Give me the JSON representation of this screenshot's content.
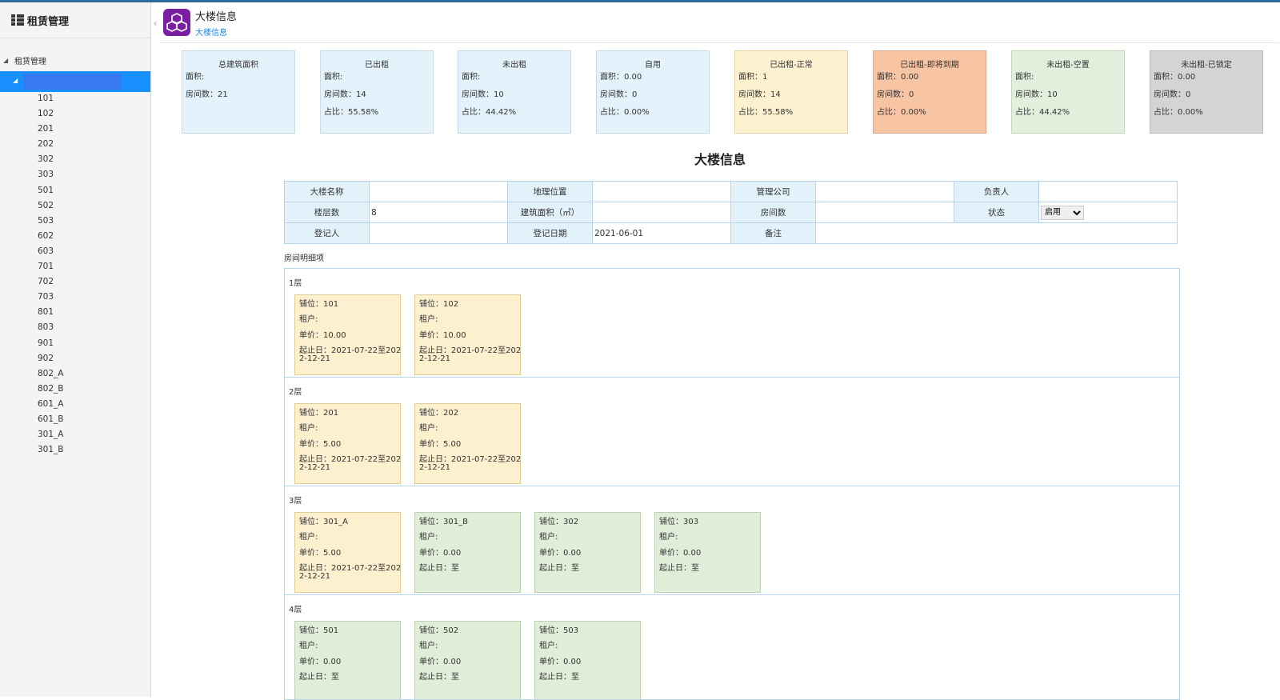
{
  "sidebar": {
    "title": "租赁管理",
    "tree_root": "租赁管理",
    "items": [
      "101",
      "102",
      "201",
      "202",
      "302",
      "303",
      "501",
      "502",
      "503",
      "602",
      "603",
      "701",
      "702",
      "703",
      "801",
      "803",
      "901",
      "902",
      "802_A",
      "802_B",
      "601_A",
      "601_B",
      "301_A",
      "301_B"
    ]
  },
  "header": {
    "title": "大楼信息",
    "breadcrumb": "大楼信息"
  },
  "stats": [
    {
      "title": "总建筑面积",
      "lines": [
        "面积:",
        "房间数：21"
      ],
      "color": "blue"
    },
    {
      "title": "已出租",
      "lines": [
        "面积:",
        "房间数：14",
        "占比：55.58%"
      ],
      "color": "blue"
    },
    {
      "title": "未出租",
      "lines": [
        "面积:",
        "房间数：10",
        "占比：44.42%"
      ],
      "color": "blue"
    },
    {
      "title": "自用",
      "lines": [
        "面积：0.00",
        "房间数：0",
        "占比：0.00%"
      ],
      "color": "blue"
    },
    {
      "title": "已出租-正常",
      "lines": [
        "面积：1",
        "房间数：14",
        "占比：55.58%"
      ],
      "color": "yellow"
    },
    {
      "title": "已出租-即将到期",
      "lines": [
        "面积：0.00",
        "房间数：0",
        "占比：0.00%"
      ],
      "color": "orange"
    },
    {
      "title": "未出租-空置",
      "lines": [
        "面积:",
        "房间数：10",
        "占比：44.42%"
      ],
      "color": "green"
    },
    {
      "title": "未出租-已锁定",
      "lines": [
        "面积：0.00",
        "房间数：0",
        "占比：0.00%"
      ],
      "color": "gray"
    }
  ],
  "building": {
    "section_title": "大楼信息",
    "labels": {
      "name": "大楼名称",
      "location": "地理位置",
      "company": "管理公司",
      "owner": "负责人",
      "floors": "楼层数",
      "area": "建筑面积（㎡）",
      "rooms": "房间数",
      "status": "状态",
      "registrant": "登记人",
      "reg_date": "登记日期",
      "remark": "备注"
    },
    "values": {
      "name": "",
      "location": "",
      "company": "",
      "owner": "",
      "floors": "8",
      "area": "",
      "rooms": "",
      "status": "启用",
      "registrant": "",
      "reg_date": "2021-06-01",
      "remark": ""
    },
    "details_label": "房间明细项"
  },
  "floors": [
    {
      "label": "1层",
      "rooms": [
        {
          "unit": "铺位：101",
          "tenant": "租户:",
          "price": "单价：10.00",
          "date": "起止日：2021-07-22至2022-12-21",
          "status": "occupied"
        },
        {
          "unit": "铺位：102",
          "tenant": "租户:",
          "price": "单价：10.00",
          "date": "起止日：2021-07-22至2022-12-21",
          "status": "occupied"
        }
      ]
    },
    {
      "label": "2层",
      "rooms": [
        {
          "unit": "铺位：201",
          "tenant": "租户:",
          "price": "单价：5.00",
          "date": "起止日：2021-07-22至2022-12-21",
          "status": "occupied"
        },
        {
          "unit": "铺位：202",
          "tenant": "租户:",
          "price": "单价：5.00",
          "date": "起止日：2021-07-22至2022-12-21",
          "status": "occupied"
        }
      ]
    },
    {
      "label": "3层",
      "rooms": [
        {
          "unit": "铺位：301_A",
          "tenant": "租户:",
          "price": "单价：5.00",
          "date": "起止日：2021-07-22至2022-12-21",
          "status": "occupied"
        },
        {
          "unit": "铺位：301_B",
          "tenant": "租户:",
          "price": "单价：0.00",
          "date": "起止日：至",
          "status": "vacant"
        },
        {
          "unit": "铺位：302",
          "tenant": "租户:",
          "price": "单价：0.00",
          "date": "起止日：至",
          "status": "vacant"
        },
        {
          "unit": "铺位：303",
          "tenant": "租户:",
          "price": "单价：0.00",
          "date": "起止日：至",
          "status": "vacant"
        }
      ]
    },
    {
      "label": "4层",
      "rooms": [
        {
          "unit": "铺位：501",
          "tenant": "租户:",
          "price": "单价：0.00",
          "date": "起止日：至",
          "status": "vacant"
        },
        {
          "unit": "铺位：502",
          "tenant": "租户:",
          "price": "单价：0.00",
          "date": "起止日：至",
          "status": "vacant"
        },
        {
          "unit": "铺位：503",
          "tenant": "租户:",
          "price": "单价：0.00",
          "date": "起止日：至",
          "status": "vacant"
        }
      ]
    }
  ]
}
